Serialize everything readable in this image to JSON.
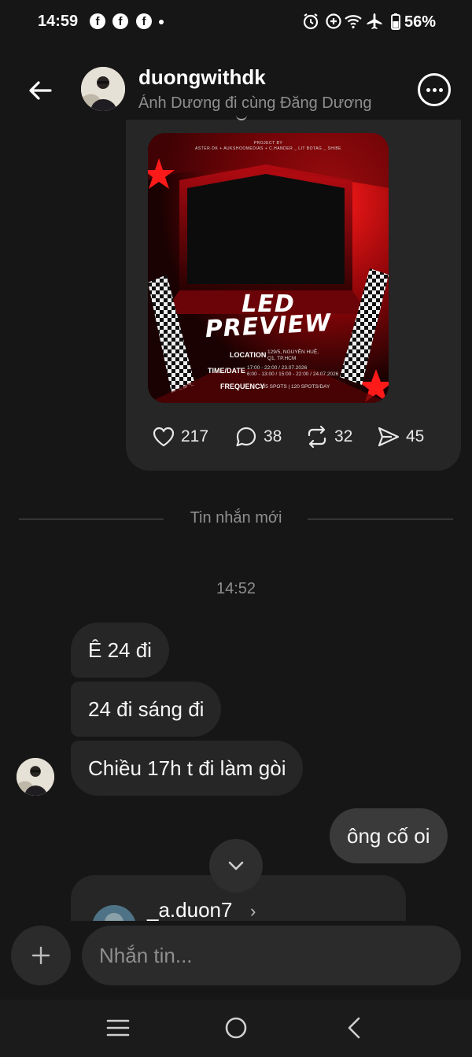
{
  "status_bar": {
    "time": "14:59",
    "battery": "56%",
    "notifications": [
      "facebook-icon",
      "facebook-icon",
      "facebook-icon"
    ],
    "system_icons": [
      "alarm-icon",
      "data-saver-icon",
      "wifi-icon",
      "airplane-icon",
      "battery-icon"
    ]
  },
  "header": {
    "name": "duongwithdk",
    "subtitle": "Ánh Dương đi cùng Đăng Dương"
  },
  "shared_post": {
    "poster": {
      "top_line_1": "PROJECT BY",
      "top_line_2": "ASTER·DK + AUKSHOOMEDIAS + C.HANDER _ LIT BOTAG _ SHIBE",
      "title_line_1": "LED",
      "title_line_2": "PREVIEW",
      "location_label": "LOCATION",
      "location_value_1": "129/5, NGUYỄN HUỆ,",
      "location_value_2": "Q1, TP.HCM",
      "time_label": "TIME/DATE",
      "time_value_1": "17:00 - 22:00 / 23.07.2026",
      "time_value_2": "6:00 - 13:00 / 15:00 - 22:00 / 24.07.2026",
      "frequency_label": "FREQUENCY",
      "frequency_value": "305 SPOTS | 120 SPOTS/DAY"
    },
    "likes": "217",
    "comments": "38",
    "reposts": "32",
    "shares": "45"
  },
  "divider_label": "Tin nhắn mới",
  "timestamp": "14:52",
  "messages": [
    {
      "text": "Ê 24 đi",
      "from": "them"
    },
    {
      "text": "24 đi sáng đi",
      "from": "them"
    },
    {
      "text": "Chiều 17h t đi làm gòi",
      "from": "them"
    },
    {
      "text": "ông cố oi",
      "from": "me"
    }
  ],
  "shared_profile": {
    "username": "_a.duon7",
    "chevron": "›"
  },
  "composer": {
    "placeholder": "Nhắn tin..."
  },
  "colors": {
    "background": "#161616",
    "bubble": "#262626",
    "my_bubble": "#3a3a3a",
    "muted_text": "#8f8f8f",
    "poster_red": "#c8101a"
  }
}
